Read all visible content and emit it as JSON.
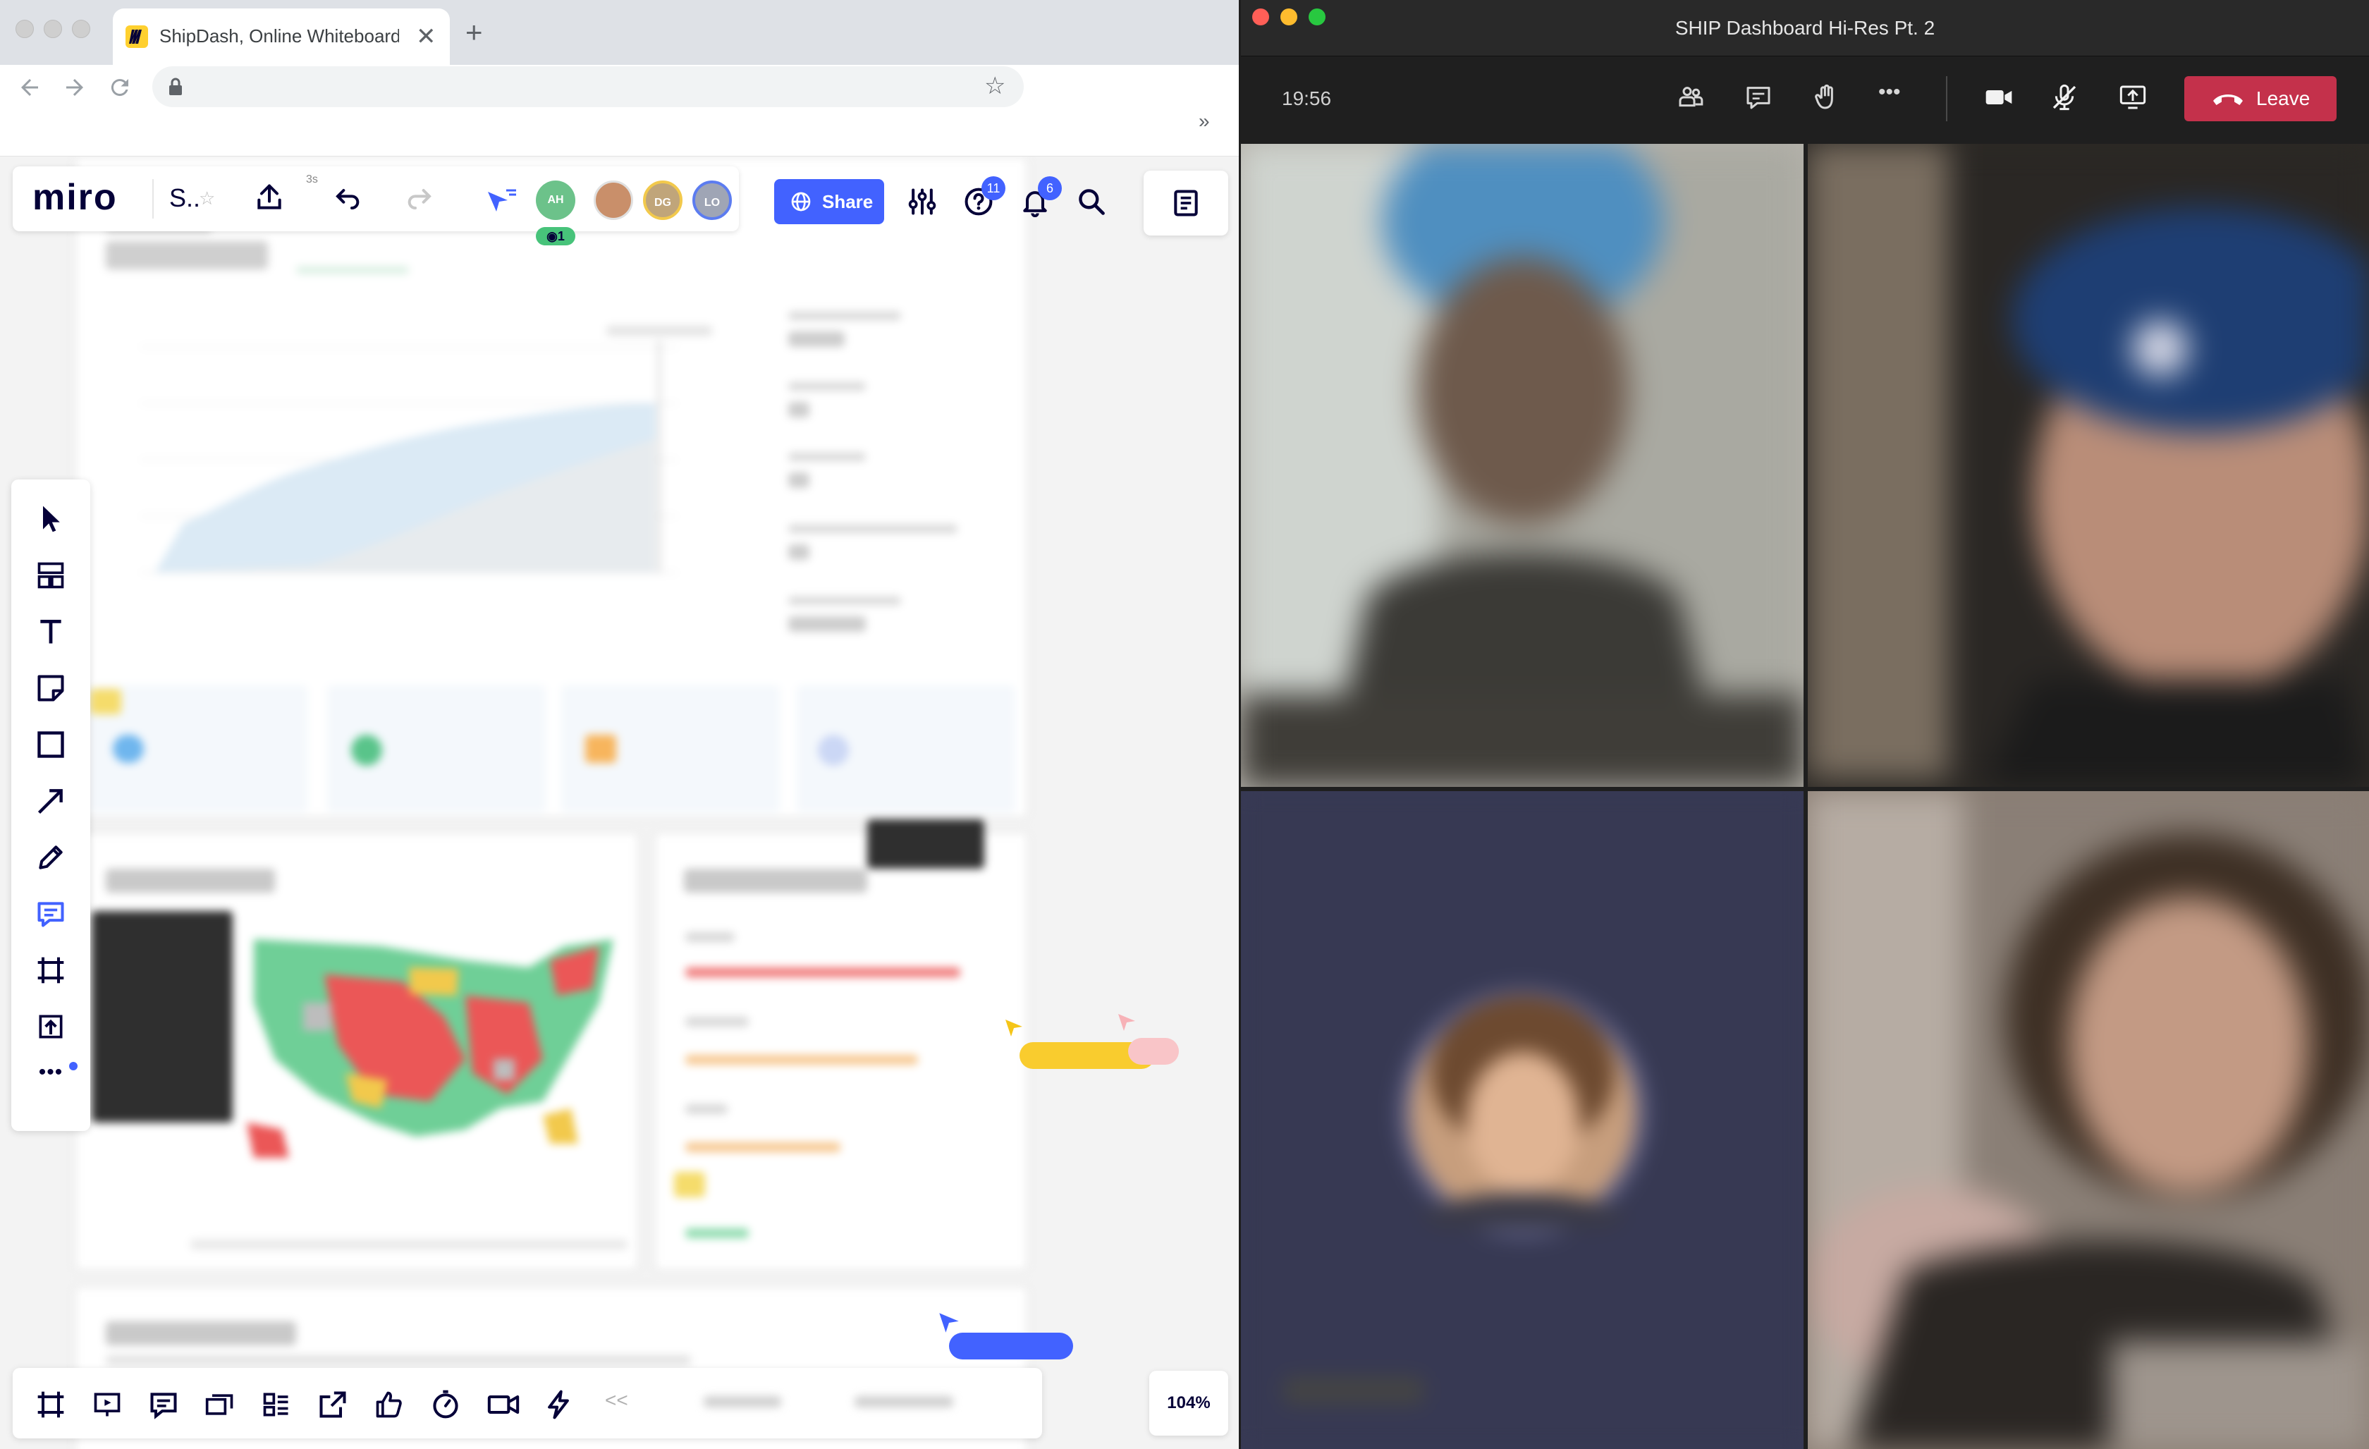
{
  "browser": {
    "tab_title": "ShipDash, Online Whiteboard for Visual Collaboration",
    "new_tab_symbol": "+",
    "close_symbol": "✕",
    "overflow_symbol": "»"
  },
  "miro": {
    "logo": "miro",
    "board_name": "S..",
    "countdown_hint": "3s",
    "share_label": "Share",
    "help_badge": "11",
    "notifications_badge": "6",
    "collaborators": [
      {
        "initials": "AH",
        "color": "#6cc28a"
      },
      {
        "initials": "",
        "color": "#c98f6a"
      },
      {
        "initials": "DG",
        "color": "#f2c94c"
      },
      {
        "initials": "LO",
        "color": "#8ea0e8"
      }
    ],
    "viewer_count": "1",
    "zoom": "104%",
    "collapse_symbol": "<<"
  },
  "teams": {
    "window_title": "SHIP Dashboard Hi-Res Pt. 2",
    "call_timer": "19:56",
    "leave_label": "Leave",
    "more_symbol": "•••"
  }
}
